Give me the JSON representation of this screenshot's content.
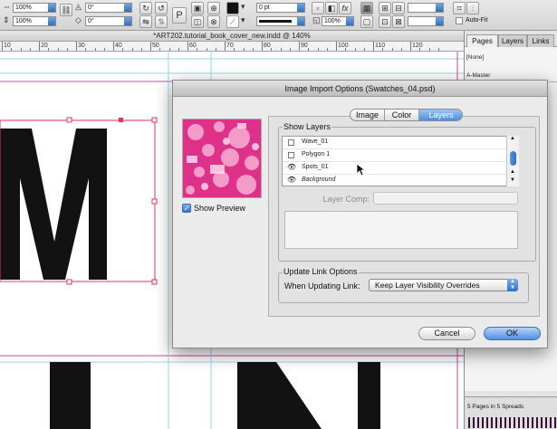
{
  "control_bar": {
    "zoom_x": "100%",
    "zoom_y": "100%",
    "rotate": "0°",
    "shear": "0°",
    "stroke_weight": "0 pt",
    "opacity": "100%",
    "auto_fit": "Auto-Fit",
    "type_tool_glyph": "P"
  },
  "document": {
    "title": "*ART202.tutorial_book_cover_new.indd @ 140%",
    "ruler_labels": [
      "10",
      "20",
      "30",
      "40",
      "50",
      "60",
      "70",
      "80",
      "90",
      "100",
      "110",
      "120"
    ],
    "canvas_letters": [
      "M",
      "I",
      "N"
    ]
  },
  "pages_panel": {
    "tabs": [
      "Pages",
      "Layers",
      "Links"
    ],
    "none_label": "[None]",
    "master_label": "A-Master",
    "status": "5 Pages in 5 Spreads"
  },
  "dialog": {
    "title": "Image Import Options (Swatches_04.psd)",
    "show_preview": "Show Preview",
    "tabs": [
      "Image",
      "Color",
      "Layers"
    ],
    "active_tab": "Layers",
    "show_layers_title": "Show Layers",
    "layers": [
      {
        "name": "Wave_01",
        "visible": false
      },
      {
        "name": "Polygon 1",
        "visible": false
      },
      {
        "name": "Spots_01",
        "visible": true
      },
      {
        "name": "Background",
        "visible": true
      }
    ],
    "layer_comp_label": "Layer Comp:",
    "update_link_title": "Update Link Options",
    "when_updating_label": "When Updating Link:",
    "when_updating_value": "Keep Layer Visibility Overrides",
    "cancel_label": "Cancel",
    "ok_label": "OK"
  },
  "colors": {
    "accent_blue": "#4d8ee0",
    "thumbnail_pink": "#e0318a",
    "guide_cyan": "#9fd3e6",
    "margin_magenta": "#c44aa0"
  }
}
